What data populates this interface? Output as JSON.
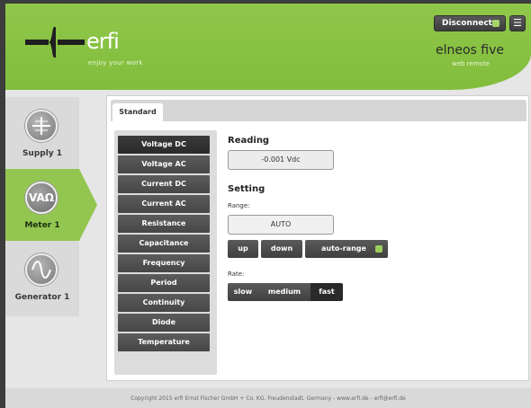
{
  "header": {
    "brand": "erfi",
    "slogan": "enjoy your work",
    "product": "elneos five",
    "product_sub": "web remote",
    "disconnect_label": "Disconnect",
    "menu_icon": "☰"
  },
  "nav": {
    "items": [
      {
        "label": "Supply 1",
        "icon": "plus-minus-icon",
        "glyph": "+"
      },
      {
        "label": "Meter 1",
        "icon": "meter-icon",
        "glyph": "VAΩ"
      },
      {
        "label": "Generator 1",
        "icon": "sine-wave-icon",
        "glyph": "∿"
      }
    ]
  },
  "tabs": [
    {
      "label": "Standard"
    }
  ],
  "functions": [
    "Voltage DC",
    "Voltage AC",
    "Current DC",
    "Current AC",
    "Resistance",
    "Capacitance",
    "Frequency",
    "Period",
    "Continuity",
    "Diode",
    "Temperature"
  ],
  "reading": {
    "title": "Reading",
    "value": "-0.001 Vdc"
  },
  "setting": {
    "title": "Setting",
    "range_label": "Range:",
    "range_value": "AUTO",
    "up_label": "up",
    "down_label": "down",
    "auto_range_label": "auto-range",
    "rate_label": "Rate:",
    "rate_options": [
      "slow",
      "medium",
      "fast"
    ]
  },
  "footer": {
    "text": "Copyright 2015 erfi Ernst Fischer GmbH + Co. KG, Freudenstadt, Germany - www.erfi.de - erfi@erfi.de"
  },
  "colors": {
    "accent": "#8fc74a",
    "dark_button": "#4a4a4a",
    "led_green": "#9bcf5c"
  }
}
